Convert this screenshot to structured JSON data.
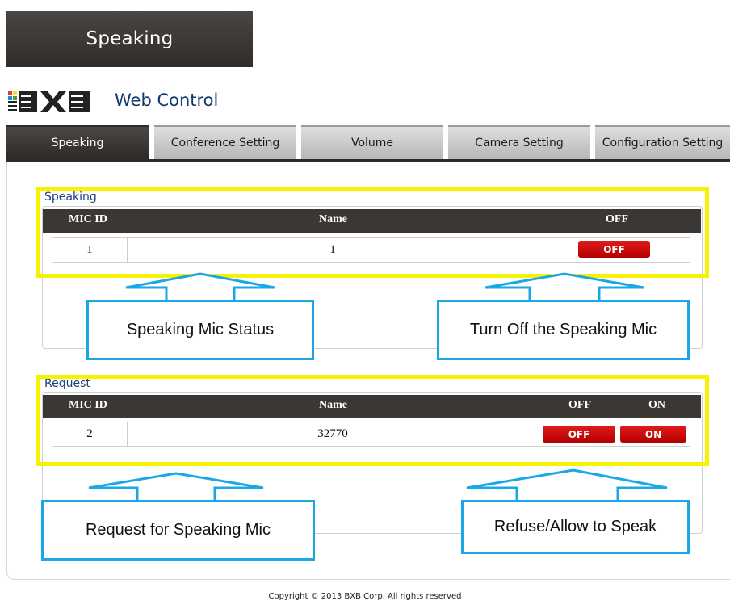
{
  "header": {
    "title": "Speaking",
    "brand": "BXB",
    "app_name": "Web Control"
  },
  "tabs": [
    {
      "label": "Speaking",
      "active": true
    },
    {
      "label": "Conference Setting",
      "active": false
    },
    {
      "label": "Volume",
      "active": false
    },
    {
      "label": "Camera Setting",
      "active": false
    },
    {
      "label": "Configuration Setting",
      "active": false
    }
  ],
  "speaking": {
    "title": "Speaking",
    "columns": [
      "MIC ID",
      "Name",
      "OFF"
    ],
    "rows": [
      {
        "mic_id": "1",
        "name": "1",
        "off_button": "OFF"
      }
    ]
  },
  "request": {
    "title": "Request",
    "columns": [
      "MIC ID",
      "Name",
      "OFF",
      "ON"
    ],
    "rows": [
      {
        "mic_id": "2",
        "name": "32770",
        "off_button": "OFF",
        "on_button": "ON"
      }
    ]
  },
  "annotations": {
    "speaking_status": "Speaking Mic Status",
    "turn_off": "Turn Off the Speaking Mic",
    "request_mic": "Request for Speaking Mic",
    "refuse_allow": "Refuse/Allow to Speak"
  },
  "footer": {
    "copyright": "Copyright © 2013 BXB Corp. All rights reserved"
  },
  "colors": {
    "tab_active": "#2d2a28",
    "button_red": "#d10000",
    "highlight_yellow": "#f7f200",
    "callout_blue": "#1aa7e8",
    "title_blue": "#123a6e"
  }
}
